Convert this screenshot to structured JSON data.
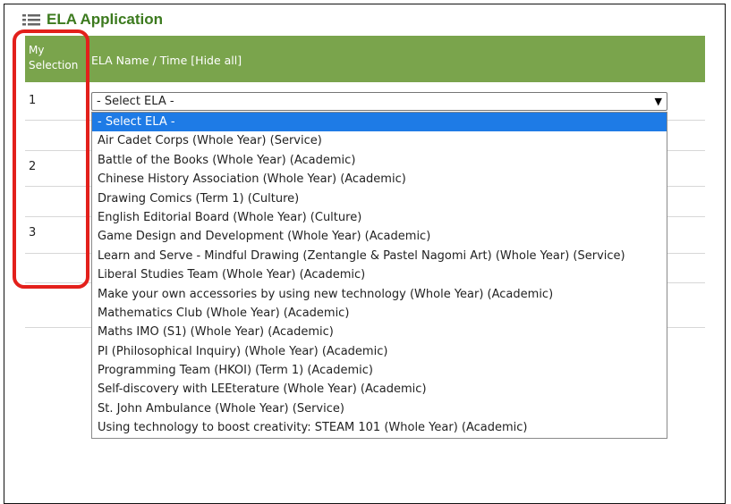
{
  "header": {
    "title": "ELA Application",
    "title_icon": "list-icon",
    "accent_color": "#3c7a1e"
  },
  "table": {
    "header_bg": "#7aa44c",
    "col_my_selection": "My Selection",
    "col_name_time": "ELA Name / Time",
    "hide_all_link": "[Hide all]",
    "rows": [
      {
        "num": "1"
      },
      {
        "num": "2"
      },
      {
        "num": "3"
      }
    ]
  },
  "select": {
    "value": "- Select ELA -"
  },
  "dropdown": {
    "highlight_color": "#1e7be6",
    "options": [
      "- Select ELA -",
      "Air Cadet Corps (Whole Year) (Service)",
      "Battle of the Books (Whole Year) (Academic)",
      "Chinese History Association (Whole Year) (Academic)",
      "Drawing Comics (Term 1) (Culture)",
      "English Editorial Board (Whole Year) (Culture)",
      "Game Design and Development (Whole Year) (Academic)",
      "Learn and Serve - Mindful Drawing (Zentangle & Pastel Nagomi Art) (Whole Year) (Service)",
      "Liberal Studies Team (Whole Year) (Academic)",
      "Make your own accessories by using new technology (Whole Year) (Academic)",
      "Mathematics Club (Whole Year) (Academic)",
      "Maths IMO (S1) (Whole Year) (Academic)",
      "PI (Philosophical Inquiry) (Whole Year) (Academic)",
      "Programming Team (HKOI) (Term 1) (Academic)",
      "Self-discovery with LEEterature (Whole Year) (Academic)",
      "St. John Ambulance (Whole Year) (Service)",
      "Using technology to boost creativity: STEAM 101 (Whole Year) (Academic)"
    ]
  },
  "annotation": {
    "highlight_color": "#e3201b"
  }
}
